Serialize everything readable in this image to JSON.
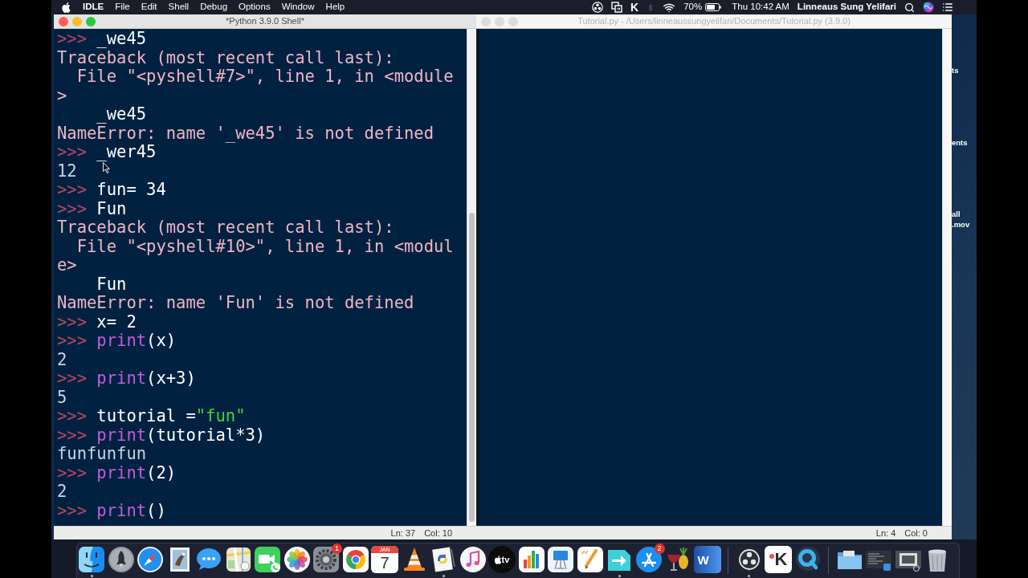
{
  "menu_bar": {
    "app": "IDLE",
    "menus": [
      "File",
      "Edit",
      "Shell",
      "Debug",
      "Options",
      "Window",
      "Help"
    ],
    "status_icons": [
      {
        "kind": "obs",
        "disabled": false
      },
      {
        "kind": "mirror",
        "disabled": false
      },
      {
        "kind": "k",
        "text": "K",
        "disabled": false
      },
      {
        "kind": "bluetooth",
        "disabled": true
      },
      {
        "kind": "wifi",
        "disabled": false
      }
    ],
    "battery": "70%",
    "clock": "Thu 10:42 AM",
    "user": "Linneaus Sung Yelifari"
  },
  "windows": [
    {
      "kind": "shell",
      "title": "*Python 3.9.0 Shell*",
      "active": true,
      "lines": [
        {
          "kind": "input",
          "prompt": ">>>",
          "segments": [
            {
              "kind": "plain",
              "text": "_we45"
            }
          ]
        },
        {
          "kind": "error",
          "text": "Traceback (most recent call last):"
        },
        {
          "kind": "error",
          "text": "  File \"<pyshell#7>\", line 1, in <module"
        },
        {
          "kind": "error",
          "text": ">"
        },
        {
          "kind": "source",
          "text": "    _we45"
        },
        {
          "kind": "error",
          "text": "NameError: name '_we45' is not defined"
        },
        {
          "kind": "input",
          "prompt": ">>>",
          "segments": [
            {
              "kind": "plain",
              "text": "_wer45"
            }
          ]
        },
        {
          "kind": "output",
          "text": "12"
        },
        {
          "kind": "input",
          "prompt": ">>>",
          "segments": [
            {
              "kind": "plain",
              "text": "fun= 34"
            }
          ]
        },
        {
          "kind": "input",
          "prompt": ">>>",
          "segments": [
            {
              "kind": "plain",
              "text": "Fun"
            }
          ]
        },
        {
          "kind": "error",
          "text": "Traceback (most recent call last):"
        },
        {
          "kind": "error",
          "text": "  File \"<pyshell#10>\", line 1, in <modul"
        },
        {
          "kind": "error",
          "text": "e>"
        },
        {
          "kind": "source",
          "text": "    Fun"
        },
        {
          "kind": "error",
          "text": "NameError: name 'Fun' is not defined"
        },
        {
          "kind": "input",
          "prompt": ">>>",
          "segments": [
            {
              "kind": "plain",
              "text": "x= 2"
            }
          ]
        },
        {
          "kind": "input",
          "prompt": ">>>",
          "segments": [
            {
              "kind": "builtin",
              "text": "print"
            },
            {
              "kind": "plain",
              "text": "(x)"
            }
          ]
        },
        {
          "kind": "output",
          "text": "2"
        },
        {
          "kind": "input",
          "prompt": ">>>",
          "segments": [
            {
              "kind": "builtin",
              "text": "print"
            },
            {
              "kind": "plain",
              "text": "(x+3)"
            }
          ]
        },
        {
          "kind": "output",
          "text": "5"
        },
        {
          "kind": "input",
          "prompt": ">>>",
          "segments": [
            {
              "kind": "plain",
              "text": "tutorial ="
            },
            {
              "kind": "string",
              "text": "\"fun\""
            }
          ]
        },
        {
          "kind": "input",
          "prompt": ">>>",
          "segments": [
            {
              "kind": "builtin",
              "text": "print"
            },
            {
              "kind": "plain",
              "text": "(tutorial*3)"
            }
          ]
        },
        {
          "kind": "output",
          "text": "funfunfun"
        },
        {
          "kind": "input",
          "prompt": ">>>",
          "segments": [
            {
              "kind": "builtin",
              "text": "print"
            },
            {
              "kind": "plain",
              "text": "(2)"
            }
          ]
        },
        {
          "kind": "output",
          "text": "2"
        },
        {
          "kind": "input",
          "prompt": ">>>",
          "segments": [
            {
              "kind": "builtin",
              "text": "print"
            },
            {
              "kind": "plain",
              "text": "()"
            }
          ]
        }
      ],
      "status": {
        "line": "Ln: 37",
        "column": "Col: 10"
      }
    },
    {
      "kind": "editor",
      "title": "Tutorial.py - /Users/linneaussungyelifari/Documents/Tutorial.py (3.9.0)",
      "active": false,
      "status": {
        "line": "Ln: 4",
        "column": "Col: 0"
      }
    }
  ],
  "desktop": {
    "labels": [
      "ts",
      "ents",
      "all",
      ".mov"
    ]
  },
  "dock": {
    "sections": [
      {
        "items": [
          {
            "kind": "finder",
            "running": true
          },
          {
            "kind": "launchpad",
            "running": false
          },
          {
            "kind": "safari",
            "running": false
          },
          {
            "kind": "mail",
            "running": false
          },
          {
            "kind": "messages",
            "running": false
          },
          {
            "kind": "maps",
            "running": false
          },
          {
            "kind": "facetime",
            "running": false
          },
          {
            "kind": "photos",
            "running": false
          },
          {
            "kind": "settings",
            "badge": "1",
            "running": false
          },
          {
            "kind": "chrome",
            "running": false
          },
          {
            "kind": "calendar",
            "month": "JAN",
            "day": "7",
            "running": false
          },
          {
            "kind": "vlc",
            "running": false
          },
          {
            "kind": "python",
            "running": true
          },
          {
            "kind": "music",
            "running": false
          },
          {
            "kind": "tv",
            "label": "tv",
            "running": false
          },
          {
            "kind": "numbers",
            "running": false
          },
          {
            "kind": "keynote",
            "running": false
          },
          {
            "kind": "pages",
            "running": false
          },
          {
            "kind": "migrate",
            "running": true
          },
          {
            "kind": "app-store",
            "badge": "2",
            "running": false
          },
          {
            "kind": "wine",
            "running": false
          },
          {
            "kind": "word",
            "label": "W",
            "running": false
          }
        ]
      },
      {
        "items": [
          {
            "kind": "obs",
            "running": true
          },
          {
            "kind": "k-app",
            "label": "K",
            "running": false
          },
          {
            "kind": "quicktime",
            "running": false
          }
        ]
      },
      {
        "items": [
          {
            "kind": "folder",
            "running": false
          },
          {
            "kind": "screenshot",
            "running": false
          },
          {
            "kind": "window-shot",
            "running": false
          },
          {
            "kind": "trash",
            "running": false
          }
        ]
      }
    ]
  }
}
